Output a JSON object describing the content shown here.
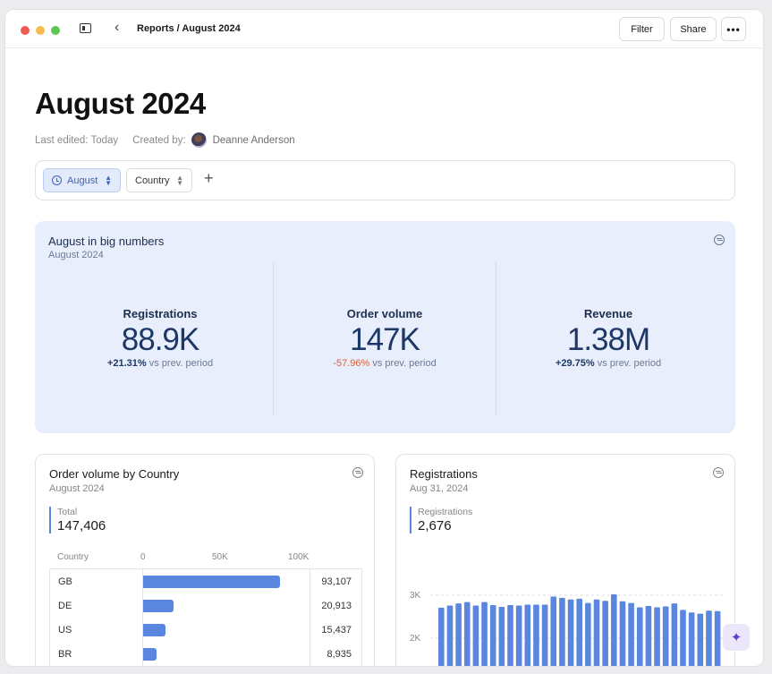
{
  "titlebar": {
    "breadcrumb": "Reports / August 2024",
    "filter_label": "Filter",
    "share_label": "Share",
    "more_label": "•••",
    "back_icon": "‹"
  },
  "page": {
    "title": "August 2024",
    "last_edited": "Last edited: Today",
    "created_by": "Created by:",
    "author": "Deanne Anderson"
  },
  "filters": {
    "month": "August",
    "country": "Country",
    "add": "+"
  },
  "big_numbers": {
    "title": "August in big numbers",
    "subtitle": "August 2024",
    "kpis": [
      {
        "label": "Registrations",
        "value": "88.9K",
        "change": "+21.31%",
        "suffix": " vs prev. period"
      },
      {
        "label": "Order volume",
        "value": "147K",
        "change": "-57.96%",
        "suffix": " vs prev. period"
      },
      {
        "label": "Revenue",
        "value": "1.38M",
        "change": "+29.75%",
        "suffix": " vs prev. period"
      }
    ]
  },
  "order_card": {
    "title": "Order volume by Country",
    "subtitle": "August 2024",
    "total_label": "Total",
    "total_value": "147,406",
    "col_country": "Country",
    "ticks": [
      "0",
      "50K",
      "100K"
    ],
    "rows": [
      {
        "country": "GB",
        "value": 93107,
        "display": "93,107"
      },
      {
        "country": "DE",
        "value": 20913,
        "display": "20,913"
      },
      {
        "country": "US",
        "value": 15437,
        "display": "15,437"
      },
      {
        "country": "BR",
        "value": 8935,
        "display": "8,935"
      }
    ]
  },
  "reg_card": {
    "title": "Registrations",
    "subtitle": "Aug 31, 2024",
    "stat_label": "Registrations",
    "stat_value": "2,676"
  },
  "chart_data": {
    "type": "bar",
    "ylabel": "",
    "xlabel": "",
    "ylim": [
      0,
      3000
    ],
    "yticks": [
      "2K",
      "3K"
    ],
    "ytick_values": [
      2000,
      3000
    ],
    "values": [
      2710,
      2760,
      2810,
      2840,
      2760,
      2840,
      2770,
      2730,
      2770,
      2760,
      2780,
      2780,
      2780,
      2970,
      2940,
      2900,
      2920,
      2820,
      2900,
      2870,
      3020,
      2860,
      2820,
      2720,
      2750,
      2720,
      2740,
      2810,
      2660,
      2600,
      2570,
      2640,
      2630
    ]
  },
  "assistant": {
    "icon": "✦"
  }
}
